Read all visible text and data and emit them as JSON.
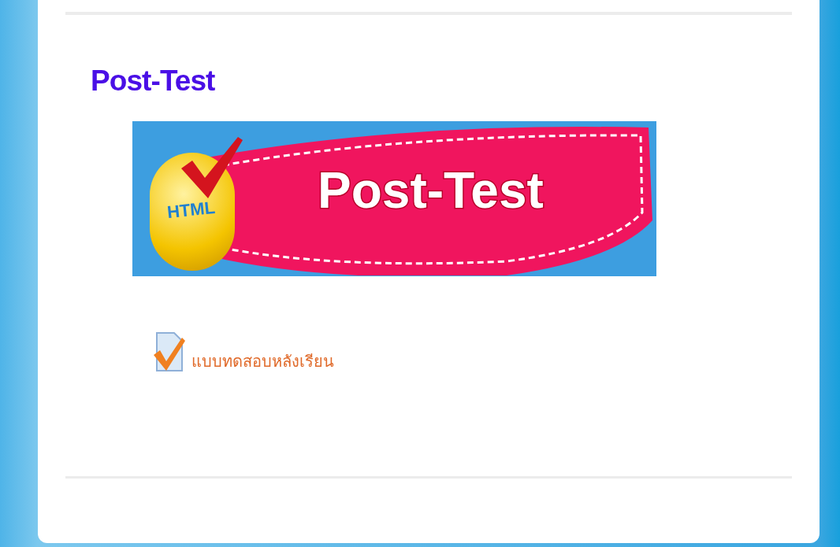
{
  "heading": "Post-Test",
  "banner": {
    "badge": "HTML",
    "title": "Post-Test"
  },
  "links": [
    {
      "label": "แบบทดสอบหลังเรียน"
    }
  ]
}
